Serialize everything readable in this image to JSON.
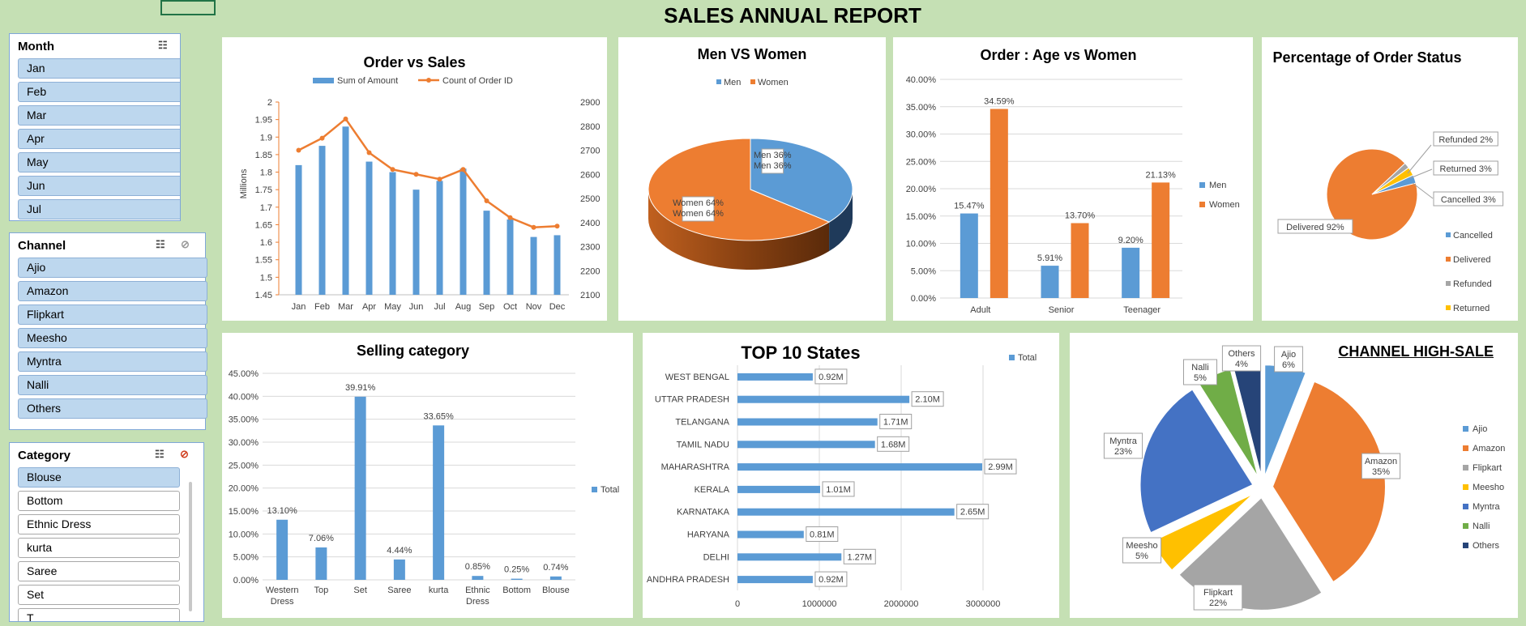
{
  "report_title": "SALES ANNUAL REPORT",
  "colors": {
    "blue": "#5b9bd5",
    "orange": "#ed7d31",
    "gray": "#a5a5a5",
    "yellow": "#ffc000",
    "darkblue": "#4472c4",
    "green": "#70ad47",
    "navy": "#264478",
    "bg": "#c5e0b4"
  },
  "slicers": {
    "month": {
      "title": "Month",
      "items": [
        {
          "label": "Jan",
          "selected": true
        },
        {
          "label": "Feb",
          "selected": true
        },
        {
          "label": "Mar",
          "selected": true
        },
        {
          "label": "Apr",
          "selected": true
        },
        {
          "label": "May",
          "selected": true
        },
        {
          "label": "Jun",
          "selected": true
        },
        {
          "label": "Jul",
          "selected": true
        }
      ]
    },
    "channel": {
      "title": "Channel",
      "items": [
        {
          "label": "Ajio",
          "selected": true
        },
        {
          "label": "Amazon",
          "selected": true
        },
        {
          "label": "Flipkart",
          "selected": true
        },
        {
          "label": "Meesho",
          "selected": true
        },
        {
          "label": "Myntra",
          "selected": true
        },
        {
          "label": "Nalli",
          "selected": true
        },
        {
          "label": "Others",
          "selected": true
        }
      ]
    },
    "category": {
      "title": "Category",
      "items": [
        {
          "label": "Blouse",
          "selected": true
        },
        {
          "label": "Bottom",
          "selected": false
        },
        {
          "label": "Ethnic Dress",
          "selected": false
        },
        {
          "label": "kurta",
          "selected": false
        },
        {
          "label": "Saree",
          "selected": false
        },
        {
          "label": "Set",
          "selected": false
        },
        {
          "label": "T",
          "selected": false
        }
      ]
    }
  },
  "chart_data": [
    {
      "id": "order-vs-sales",
      "type": "bar",
      "title": "Order vs Sales",
      "categories": [
        "Jan",
        "Feb",
        "Mar",
        "Apr",
        "May",
        "Jun",
        "Jul",
        "Aug",
        "Sep",
        "Oct",
        "Nov",
        "Dec"
      ],
      "series": [
        {
          "name": "Sum of Amount",
          "kind": "bar",
          "axis": "left",
          "values": [
            1.82,
            1.875,
            1.93,
            1.83,
            1.8,
            1.75,
            1.775,
            1.81,
            1.69,
            1.665,
            1.615,
            1.62
          ]
        },
        {
          "name": "Count of Order ID",
          "kind": "line",
          "axis": "right",
          "values": [
            2700,
            2750,
            2830,
            2690,
            2620,
            2600,
            2580,
            2620,
            2490,
            2420,
            2380,
            2385
          ]
        }
      ],
      "ylabel": "Millions",
      "y_left": {
        "min": 1.45,
        "max": 2,
        "ticks": [
          "1.45",
          "1.5",
          "1.55",
          "1.6",
          "1.65",
          "1.7",
          "1.75",
          "1.8",
          "1.85",
          "1.9",
          "1.95",
          "2"
        ]
      },
      "y_right": {
        "min": 2100,
        "max": 2900,
        "ticks": [
          "2100",
          "2200",
          "2300",
          "2400",
          "2500",
          "2600",
          "2700",
          "2800",
          "2900"
        ]
      }
    },
    {
      "id": "men-vs-women",
      "type": "pie",
      "title": "Men VS Women",
      "legend": [
        "Men",
        "Women"
      ],
      "slices": [
        {
          "label": "Men",
          "value": 36,
          "text": "Men\n36%"
        },
        {
          "label": "Women",
          "value": 64,
          "text": "Women\n64%"
        }
      ]
    },
    {
      "id": "age-vs-women",
      "type": "bar",
      "title": "Order : Age vs Women",
      "categories": [
        "Adult",
        "Senior",
        "Teenager"
      ],
      "series": [
        {
          "name": "Men",
          "values": [
            15.47,
            5.91,
            9.2
          ],
          "labels": [
            "15.47%",
            "5.91%",
            "9.20%"
          ]
        },
        {
          "name": "Women",
          "values": [
            34.59,
            13.7,
            21.13
          ],
          "labels": [
            "34.59%",
            "13.70%",
            "21.13%"
          ]
        }
      ],
      "ylim": [
        0,
        40
      ],
      "ticks": [
        "0.00%",
        "5.00%",
        "10.00%",
        "15.00%",
        "20.00%",
        "25.00%",
        "30.00%",
        "35.00%",
        "40.00%"
      ]
    },
    {
      "id": "order-status",
      "type": "pie",
      "title": "Percentage of Order Status",
      "slices": [
        {
          "label": "Delivered",
          "value": 92,
          "text": "Delivered 92%"
        },
        {
          "label": "Refunded",
          "value": 2,
          "text": "Refunded 2%"
        },
        {
          "label": "Returned",
          "value": 3,
          "text": "Returned 3%"
        },
        {
          "label": "Cancelled",
          "value": 3,
          "text": "Cancelled 3%"
        }
      ],
      "legend": [
        "Cancelled",
        "Delivered",
        "Refunded",
        "Returned"
      ]
    },
    {
      "id": "selling-category",
      "type": "bar",
      "title": "Selling category",
      "categories": [
        "Western Dress",
        "Top",
        "Set",
        "Saree",
        "kurta",
        "Ethnic Dress",
        "Bottom",
        "Blouse"
      ],
      "series": [
        {
          "name": "Total",
          "values": [
            13.1,
            7.06,
            39.91,
            4.44,
            33.65,
            0.85,
            0.25,
            0.74
          ],
          "labels": [
            "13.10%",
            "7.06%",
            "39.91%",
            "4.44%",
            "33.65%",
            "0.85%",
            "0.25%",
            "0.74%"
          ]
        }
      ],
      "ylim": [
        0,
        45
      ],
      "ticks": [
        "0.00%",
        "5.00%",
        "10.00%",
        "15.00%",
        "20.00%",
        "25.00%",
        "30.00%",
        "35.00%",
        "40.00%",
        "45.00%"
      ]
    },
    {
      "id": "top-10-states",
      "type": "bar",
      "orientation": "horizontal",
      "title": "TOP 10 States",
      "categories": [
        "WEST BENGAL",
        "UTTAR PRADESH",
        "TELANGANA",
        "TAMIL NADU",
        "MAHARASHTRA",
        "KERALA",
        "KARNATAKA",
        "HARYANA",
        "DELHI",
        "ANDHRA PRADESH"
      ],
      "series": [
        {
          "name": "Total",
          "values": [
            920000,
            2100000,
            1710000,
            1680000,
            2990000,
            1010000,
            2650000,
            810000,
            1270000,
            920000
          ],
          "labels": [
            "0.92M",
            "2.10M",
            "1.71M",
            "1.68M",
            "2.99M",
            "1.01M",
            "2.65M",
            "0.81M",
            "1.27M",
            "0.92M"
          ]
        }
      ],
      "xlim": [
        0,
        3000000
      ],
      "ticks": [
        "0",
        "1000000",
        "2000000",
        "3000000"
      ]
    },
    {
      "id": "channel-high-sale",
      "type": "pie",
      "title": "CHANNEL HIGH-SALE",
      "slices": [
        {
          "label": "Ajio",
          "value": 6,
          "text": "Ajio\n6%"
        },
        {
          "label": "Amazon",
          "value": 35,
          "text": "Amazon\n35%"
        },
        {
          "label": "Flipkart",
          "value": 22,
          "text": "Flipkart\n22%"
        },
        {
          "label": "Meesho",
          "value": 5,
          "text": "Meesho\n5%"
        },
        {
          "label": "Myntra",
          "value": 23,
          "text": "Myntra\n23%"
        },
        {
          "label": "Nalli",
          "value": 5,
          "text": "Nalli\n5%"
        },
        {
          "label": "Others",
          "value": 4,
          "text": "Others\n4%"
        }
      ],
      "legend": [
        "Ajio",
        "Amazon",
        "Flipkart",
        "Meesho",
        "Myntra",
        "Nalli",
        "Others"
      ]
    }
  ]
}
